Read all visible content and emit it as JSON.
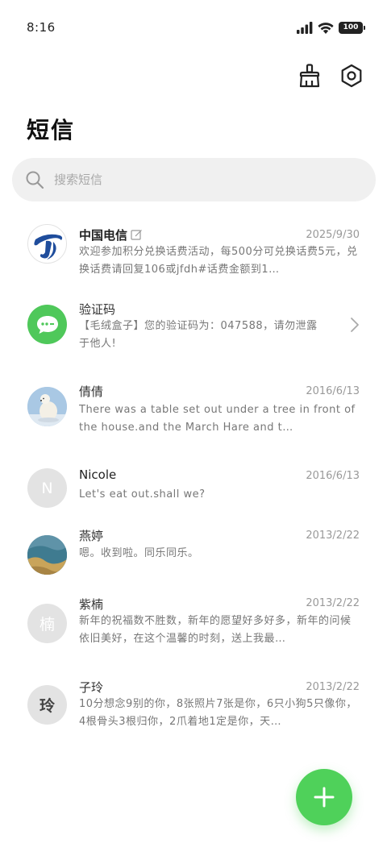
{
  "status_bar": {
    "time": "8:16",
    "battery": "100",
    "icons": [
      "signal-icon",
      "wifi-icon",
      "battery-icon"
    ]
  },
  "header": {
    "title": "短信",
    "actions": [
      "clean-icon",
      "settings-icon"
    ]
  },
  "search": {
    "placeholder": "搜索短信",
    "icon": "search-icon"
  },
  "conversations": [
    {
      "name": "中国电信",
      "date": "2025/9/30",
      "preview": "欢迎参加积分兑换话费活动，每500分可兑换话费5元，兑换话费请回复106或jfdh#话费金额到1…",
      "avatar": "china-telecom-logo",
      "badge_icon": "edit-icon"
    },
    {
      "name": "验证码",
      "date": "",
      "preview": "【毛绒盒子】您的验证码为：047588，请勿泄露于他人!",
      "avatar": "message-bubble-icon",
      "avatar_color": "#4fc85a"
    },
    {
      "name": "倩倩",
      "date": "2016/6/13",
      "preview": "There was a table set out under a tree in front of the house.and the March Hare and t…",
      "avatar": "polar-bear-photo"
    },
    {
      "name": "Nicole",
      "date": "2016/6/13",
      "preview": "Let's eat out.shall we?",
      "avatar_letter": "N"
    },
    {
      "name": "燕婷",
      "date": "2013/2/22",
      "preview": "嗯。收到啦。同乐同乐。",
      "avatar": "landscape-photo"
    },
    {
      "name": "紫楠",
      "date": "2013/2/22",
      "preview": "新年的祝福数不胜数，新年的愿望好多好多，新年的问候依旧美好，在这个温馨的时刻，送上我最…",
      "avatar_letter": "楠"
    },
    {
      "name": "子玲",
      "date": "2013/2/22",
      "preview": "10分想念9别的你，8张照片7张是你，6只小狗5只像你，4根骨头3根归你，2爪着地1定是你，天…",
      "avatar_letter": "玲"
    }
  ],
  "fab": {
    "icon": "plus-icon",
    "color": "#4fd15a"
  }
}
